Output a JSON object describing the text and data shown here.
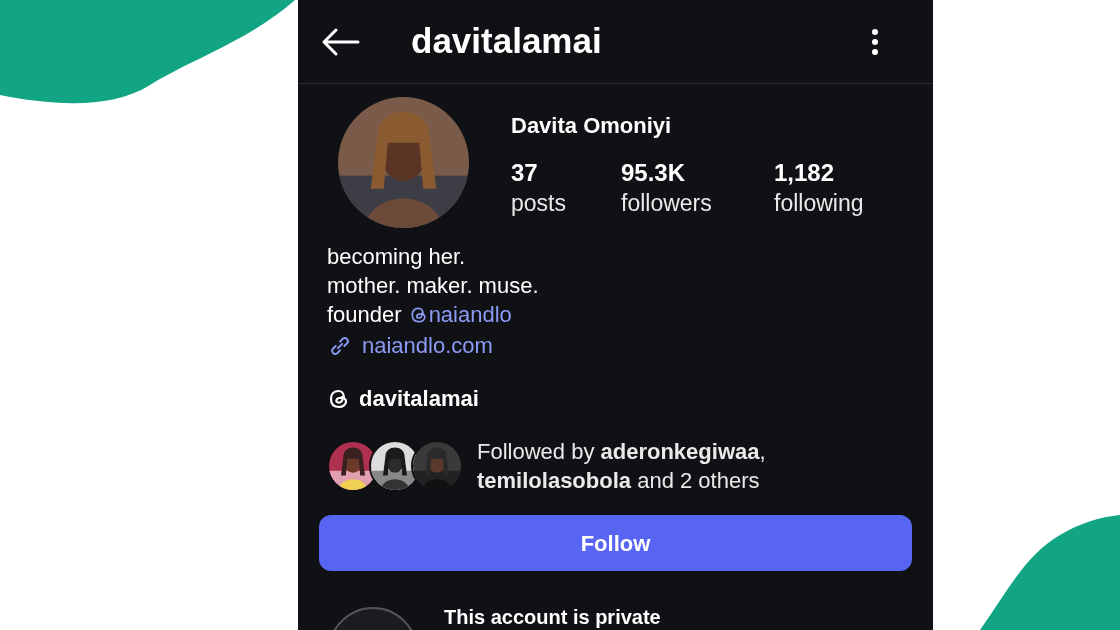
{
  "header": {
    "title": "davitalamai"
  },
  "profile": {
    "name": "Davita Omoniyi",
    "stats": [
      {
        "value": "37",
        "label": "posts"
      },
      {
        "value": "95.3K",
        "label": "followers"
      },
      {
        "value": "1,182",
        "label": "following"
      }
    ]
  },
  "bio": {
    "lines": [
      "becoming her.",
      "mother. maker. muse."
    ],
    "founder": "founder",
    "mention": "naiandlo",
    "link": "naiandlo.com"
  },
  "threads_handle": "davitalamai",
  "followed_by": {
    "text": "Followed by **aderonkegiwaa**, **temilolasobola** and 2 others"
  },
  "follow_button": "Follow",
  "private_notice": "This account is private"
}
